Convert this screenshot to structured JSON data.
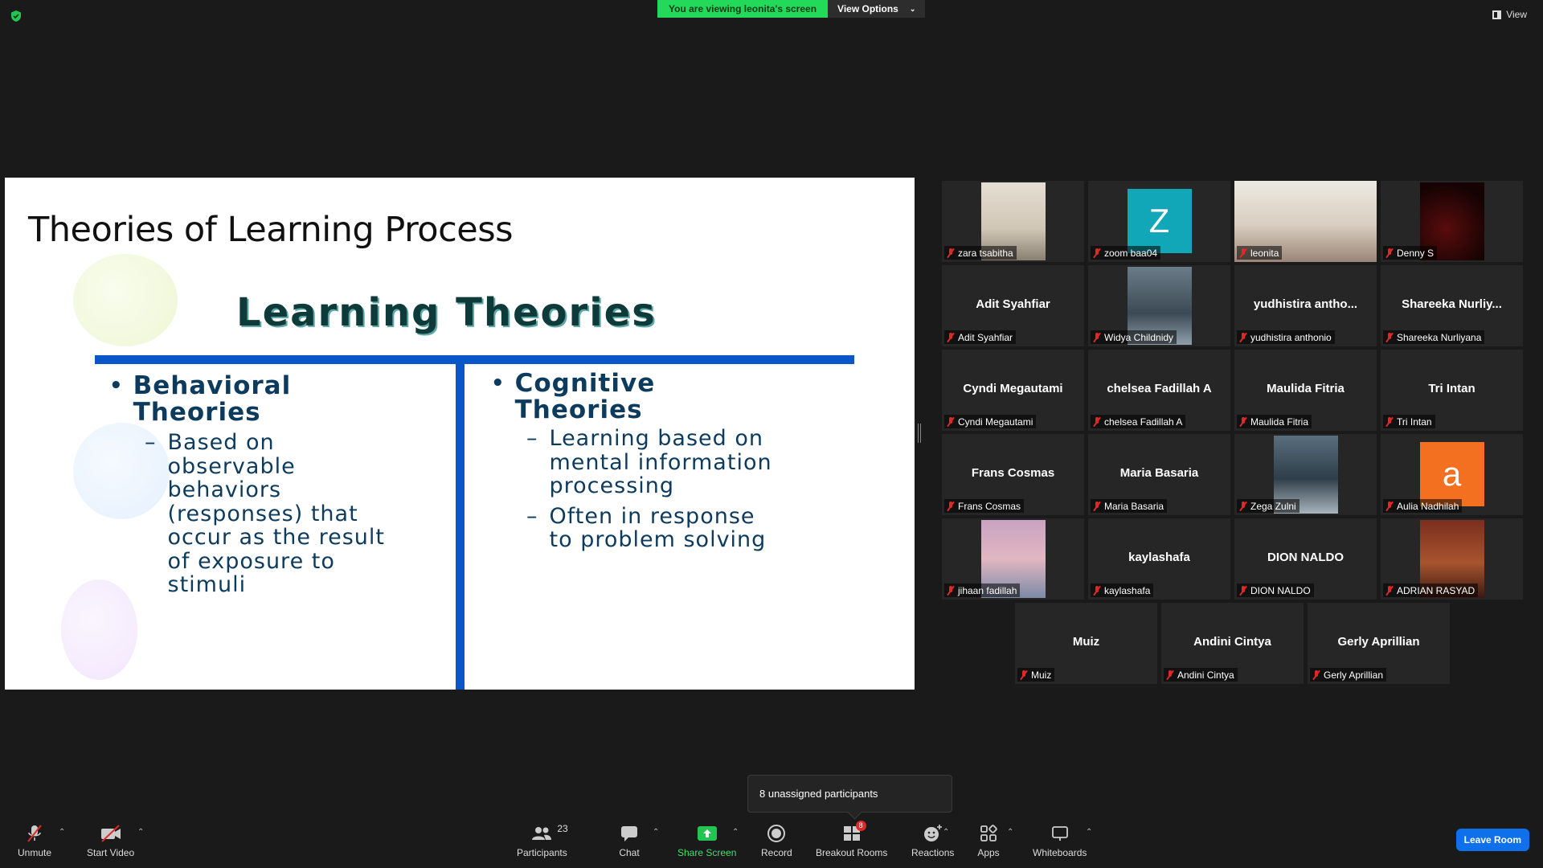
{
  "top_bar": {
    "viewing_label": "You are viewing leonita's screen",
    "view_options_label": "View Options",
    "view_label": "View"
  },
  "slide": {
    "title": "Theories of Learning Process",
    "heading": "Learning Theories",
    "left": {
      "head_line1": "Behavioral",
      "head_line2": "Theories",
      "sub_lines": [
        "Based on",
        "observable",
        "behaviors",
        "(responses) that",
        "occur as the result",
        "of exposure to",
        "stimuli"
      ]
    },
    "right": {
      "head_line1": "Cognitive",
      "head_line2": "Theories",
      "sub1_lines": [
        "Learning based on",
        "mental information",
        "processing"
      ],
      "sub2_lines": [
        "Often in response",
        "to problem solving"
      ]
    }
  },
  "participants": [
    {
      "display": "",
      "name": "zara tsabitha",
      "type": "video",
      "active": false
    },
    {
      "display": "Z",
      "name": "zoom baa04",
      "type": "letter",
      "color": "#11a6b8",
      "active": false
    },
    {
      "display": "",
      "name": "leonita",
      "type": "video",
      "active": true
    },
    {
      "display": "",
      "name": "Denny S",
      "type": "video",
      "active": false
    },
    {
      "display": "Adit Syahfiar",
      "name": "Adit Syahfiar",
      "type": "name",
      "active": false
    },
    {
      "display": "",
      "name": "Widya Childnidy",
      "type": "video",
      "active": false
    },
    {
      "display": "yudhistira antho...",
      "name": "yudhistira anthonio",
      "type": "name",
      "active": false
    },
    {
      "display": "Shareeka Nurliy...",
      "name": "Shareeka Nurliyana",
      "type": "name",
      "active": false
    },
    {
      "display": "Cyndi Megautami",
      "name": "Cyndi Megautami",
      "type": "name",
      "active": false
    },
    {
      "display": "chelsea Fadillah A",
      "name": "chelsea Fadillah A",
      "type": "name",
      "active": false
    },
    {
      "display": "Maulida Fitria",
      "name": "Maulida Fitria",
      "type": "name",
      "active": false
    },
    {
      "display": "Tri Intan",
      "name": "Tri Intan",
      "type": "name",
      "active": false
    },
    {
      "display": "Frans Cosmas",
      "name": "Frans Cosmas",
      "type": "name",
      "active": false
    },
    {
      "display": "Maria Basaria",
      "name": "Maria Basaria",
      "type": "name",
      "active": false
    },
    {
      "display": "",
      "name": "Zega Zulni",
      "type": "video",
      "active": false
    },
    {
      "display": "a",
      "name": "Aulia Nadhilah",
      "type": "letter",
      "color": "#f37021",
      "active": false
    },
    {
      "display": "",
      "name": "jihaan fadillah",
      "type": "video",
      "active": false
    },
    {
      "display": "kaylashafa",
      "name": "kaylashafa",
      "type": "name",
      "active": false
    },
    {
      "display": "DION NALDO",
      "name": "DION NALDO",
      "type": "name",
      "active": false
    },
    {
      "display": "",
      "name": "ADRIAN RASYAD",
      "type": "video",
      "active": false
    },
    {
      "display": "Muiz",
      "name": "Muiz",
      "type": "name",
      "active": false
    },
    {
      "display": "Andini Cintya",
      "name": "Andini Cintya",
      "type": "name",
      "active": false
    },
    {
      "display": "Gerly Aprillian",
      "name": "Gerly Aprillian",
      "type": "name",
      "active": false
    }
  ],
  "popup": {
    "text": "8 unassigned participants"
  },
  "toolbar": {
    "unmute": "Unmute",
    "start_video": "Start Video",
    "participants": "Participants",
    "participants_count": "23",
    "chat": "Chat",
    "share_screen": "Share Screen",
    "record": "Record",
    "breakout_rooms": "Breakout Rooms",
    "breakout_badge": "8",
    "reactions": "Reactions",
    "apps": "Apps",
    "whiteboards": "Whiteboards",
    "leave": "Leave Room"
  },
  "colors": {
    "accent_green": "#23d959",
    "active_speaker": "#d6e84a",
    "leave_blue": "#0e71eb",
    "slide_blue": "#0a55c8"
  }
}
